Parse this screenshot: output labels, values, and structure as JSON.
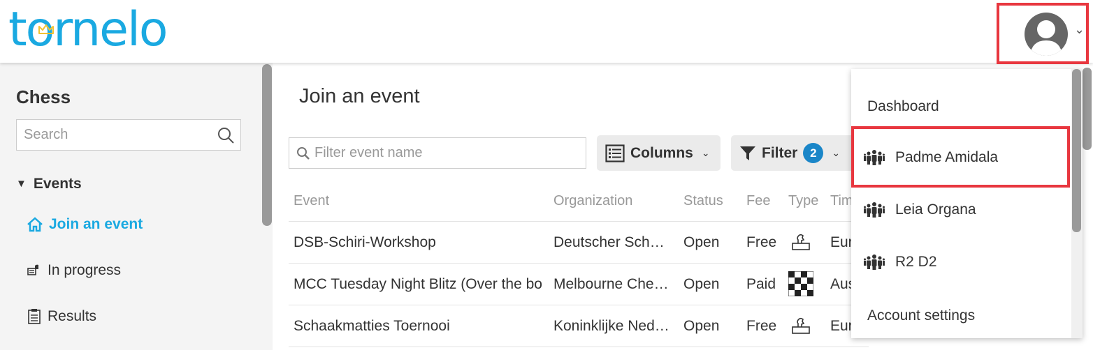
{
  "app": {
    "logo_text": "tornelo"
  },
  "sidebar": {
    "title": "Chess",
    "search_placeholder": "Search",
    "events_label": "Events",
    "items": [
      {
        "label": "Join an event",
        "active": true
      },
      {
        "label": "In progress",
        "active": false
      },
      {
        "label": "Results",
        "active": false
      }
    ]
  },
  "main": {
    "title": "Join an event",
    "filter_placeholder": "Filter event name",
    "columns_label": "Columns",
    "filter_label": "Filter",
    "filter_count": "2",
    "table": {
      "headers": [
        "Event",
        "Organization",
        "Status",
        "Fee",
        "Type",
        "Tim"
      ],
      "rows": [
        {
          "event": "DSB-Schiri-Workshop",
          "organization": "Deutscher Sch…",
          "status": "Open",
          "fee": "Free",
          "type_icon": "over-the-board-icon",
          "time": "Eur"
        },
        {
          "event": "MCC Tuesday Night Blitz (Over the bo",
          "organization": "Melbourne Che…",
          "status": "Open",
          "fee": "Paid",
          "type_icon": "chessboard-icon",
          "time": "Aus"
        },
        {
          "event": "Schaakmatties Toernooi",
          "organization": "Koninklijke Ned…",
          "status": "Open",
          "fee": "Free",
          "type_icon": "over-the-board-icon",
          "time": "Eur"
        }
      ]
    }
  },
  "user_menu": {
    "items": [
      {
        "label": "Dashboard",
        "icon": null
      },
      {
        "label": "Padme Amidala",
        "icon": "people-icon"
      },
      {
        "label": "Leia Organa",
        "icon": "people-icon"
      },
      {
        "label": "R2 D2",
        "icon": "people-icon"
      },
      {
        "label": "Account settings",
        "icon": null
      }
    ]
  },
  "colors": {
    "brand": "#1aa9e1",
    "highlight": "#e8373f",
    "badge": "#1a86c8"
  }
}
